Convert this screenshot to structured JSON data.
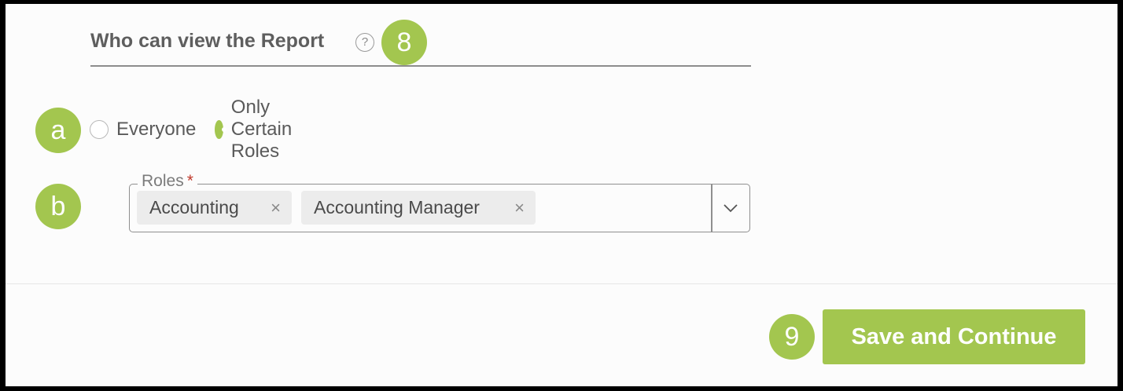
{
  "section": {
    "title": "Who can view the Report",
    "help_icon_glyph": "?"
  },
  "callouts": {
    "step8": "8",
    "a": "a",
    "b": "b",
    "step9": "9",
    "color": "#a3c64f"
  },
  "visibility": {
    "options": [
      {
        "label": "Everyone",
        "selected": false
      },
      {
        "label": "Only Certain Roles",
        "selected": true
      }
    ]
  },
  "roles_field": {
    "label": "Roles",
    "required_mark": "*",
    "selected_roles": [
      {
        "label": "Accounting",
        "remove_glyph": "×"
      },
      {
        "label": "Accounting Manager",
        "remove_glyph": "×"
      }
    ],
    "dropdown_icon": "chevron-down-icon"
  },
  "footer": {
    "save_label": "Save and Continue"
  },
  "colors": {
    "accent": "#a3c64f",
    "required": "#c0392b",
    "chip_background": "#ececec"
  }
}
